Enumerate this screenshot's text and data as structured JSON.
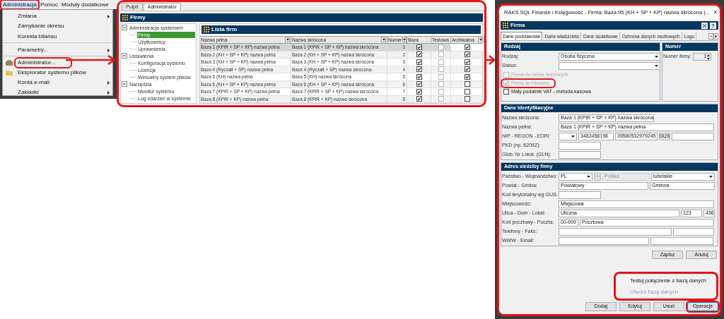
{
  "menu_bar": [
    {
      "label": "Administracja",
      "selected": true,
      "highlighted": true
    },
    {
      "label": "Pomoc",
      "selected": false,
      "highlighted": false
    },
    {
      "label": "Moduły dodatkowe",
      "selected": false,
      "highlighted": false
    }
  ],
  "menu": [
    {
      "label": "Zmiana",
      "kind": "plain",
      "submenu": true,
      "separator_after": false,
      "highlighted": false
    },
    {
      "label": "Zamykanie okresu",
      "kind": "plain",
      "submenu": false,
      "separator_after": false,
      "highlighted": false
    },
    {
      "label": "Korekta bilansu",
      "kind": "plain",
      "submenu": false,
      "separator_after": true,
      "highlighted": false
    },
    {
      "label": "Parametry...",
      "kind": "plain",
      "submenu": true,
      "separator_after": true,
      "highlighted": false
    },
    {
      "label": "Administrator...",
      "kind": "tool",
      "submenu": false,
      "separator_after": false,
      "highlighted": true
    },
    {
      "label": "Eksplorator systemu plików",
      "kind": "folder",
      "submenu": false,
      "separator_after": false,
      "highlighted": false
    },
    {
      "label": "Konta e-mail",
      "kind": "plain",
      "submenu": true,
      "separator_after": false,
      "highlighted": false
    },
    {
      "label": "Zakładki",
      "kind": "plain",
      "submenu": true,
      "separator_after": false,
      "highlighted": false
    }
  ],
  "admin_window": {
    "highlighted": true,
    "tabs": [
      {
        "label": "Pulpit",
        "selected": false
      },
      {
        "label": "Administrator",
        "selected": true
      }
    ],
    "title": "Firmy",
    "tree": [
      {
        "label": "Administracja systemem",
        "selected": false,
        "expanded": true,
        "children": [
          {
            "label": "Firmy",
            "selected": true
          },
          {
            "label": "Użytkownicy",
            "selected": false
          },
          {
            "label": "Uprawnienia",
            "selected": false
          }
        ]
      },
      {
        "label": "Ustawienia",
        "selected": false,
        "expanded": true,
        "children": [
          {
            "label": "Konfiguracja systemu",
            "selected": false
          },
          {
            "label": "Licencje",
            "selected": false
          },
          {
            "label": "Wirtualny system plików",
            "selected": false
          }
        ]
      },
      {
        "label": "Narzędzia",
        "selected": false,
        "expanded": true,
        "children": [
          {
            "label": "Monitor systemu",
            "selected": false
          },
          {
            "label": "Log zdarzeń w systemie",
            "selected": false
          }
        ]
      }
    ],
    "list": {
      "title": "Lista firm",
      "columns": [
        {
          "label": "Nazwa pełna",
          "filter": true
        },
        {
          "label": "Nazwa skrócona",
          "filter": true
        },
        {
          "label": "Numer",
          "filter": true
        },
        {
          "label": "Baza",
          "filter": false
        },
        {
          "label": "Testowa",
          "filter": false
        },
        {
          "label": "Archiwalna",
          "filter": true
        }
      ],
      "rows": [
        {
          "selected": true,
          "full": "Baza 1 (KPiR + SP + KP) nazwa pełna",
          "short": "Baza 1 (KPiR + SP + KP) nazwa skrócona",
          "number": "1",
          "baza": true,
          "testowa": false,
          "archiwalna": true
        },
        {
          "selected": false,
          "full": "Baza 2 (KH + SP + KP) nazwa pełna",
          "short": "Baza 2 (KH + SP + KP) nazwa skrócona",
          "number": "2",
          "baza": true,
          "testowa": false,
          "archiwalna": true
        },
        {
          "selected": false,
          "full": "Baza 3 (KH + SP + KP) nazwa pełna",
          "short": "Baza 3 (KH + SP + KP) nazwa skrócona",
          "number": "3",
          "baza": true,
          "testowa": false,
          "archiwalna": true
        },
        {
          "selected": false,
          "full": "Baza 4 (Ryczałt + SP) nazwa pełna",
          "short": "Baza 4 (Ryczałt + SP) nazwa skrócona",
          "number": "4",
          "baza": true,
          "testowa": false,
          "archiwalna": true
        },
        {
          "selected": false,
          "full": "Baza 5 (KH) nazwa pełna",
          "short": "Baza 5 (KH) nazwa skrócona",
          "number": "5",
          "baza": true,
          "testowa": false,
          "archiwalna": true
        },
        {
          "selected": false,
          "full": "Baza 6 (KH + SP + KP) nazwa pełna",
          "short": "Baza 6 (KH + SP + KP) nazwa skrócona",
          "number": "6",
          "baza": true,
          "testowa": false,
          "archiwalna": false
        },
        {
          "selected": false,
          "full": "Baza 7 (KPiR + SP + KP) nazwa pełna",
          "short": "Baza 7 (KPiR + SP + KP) nazwa skrócona",
          "number": "7",
          "baza": true,
          "testowa": false,
          "archiwalna": false
        },
        {
          "selected": false,
          "full": "Baza 8 (KPiR + KP) nazwa pełna",
          "short": "Baza 8 (KPiR + KP) nazwa skrócona",
          "number": "8",
          "baza": true,
          "testowa": false,
          "archiwalna": false
        }
      ]
    }
  },
  "dialog": {
    "highlighted": true,
    "title": "RAKS SQL Finanse i Księgowość - Firma: Baza 95 (KH + SP + KP) nazwa skrócona (...",
    "close": "×",
    "panel_title": "Firma",
    "help": "?",
    "tabs": [
      {
        "label": "Dane podstawowe",
        "selected": true
      },
      {
        "label": "Dane właściciela",
        "selected": false
      },
      {
        "label": "Dane dodatkowe",
        "selected": false
      },
      {
        "label": "Ochrona danych osobowych",
        "selected": false
      },
      {
        "label": "Logo",
        "selected": false
      }
    ],
    "rodzaj": {
      "title": "Rodzaj",
      "rows": [
        {
          "label": "Rodzaj:",
          "fields": [
            {
              "kind": "dropdown",
              "value": "Osoba fizyczna"
            }
          ]
        },
        {
          "label": "Status:",
          "fields": [
            {
              "kind": "dropdown"
            }
          ]
        }
      ],
      "checkboxes": [
        {
          "label": "Firma do celów testowych",
          "checked": false,
          "disabled": true,
          "highlighted": false
        },
        {
          "label": "Firma archiwalna",
          "checked": true,
          "disabled": true,
          "highlighted": true
        },
        {
          "label": "Mały podatnik VAT - metoda kasowa",
          "checked": false,
          "disabled": false,
          "highlighted": false
        }
      ]
    },
    "numer": {
      "title": "Numer",
      "label": "Numer firmy:",
      "value": "1"
    },
    "sections": [
      {
        "title": "Dane identyfikacyjne",
        "rows": [
          {
            "label": "Nazwa skrócona:",
            "fields": [
              {
                "kind": "text",
                "value": "Baza 1 (KPiR + SP + KP) nazwa skrócona"
              }
            ]
          },
          {
            "label": "Nazwa pełna:",
            "fields": [
              {
                "kind": "text",
                "value": "Baza 1 (KPiR + SP + KP) nazwa pełna"
              }
            ]
          },
          {
            "label": "NIP - REGON - EORI:",
            "fields": [
              {
                "kind": "dropdown"
              },
              {
                "kind": "text",
                "value": "3482458198"
              },
              {
                "kind": "text",
                "value": "39580532979245"
              },
              {
                "kind": "button",
                "value": "GUS"
              },
              {
                "kind": "text"
              }
            ]
          },
          {
            "label": "PKD (np. 6209Z):",
            "fields": [
              {
                "kind": "text"
              }
            ]
          },
          {
            "label": "Glob. Nr Lokal. (GLN):",
            "fields": [
              {
                "kind": "text"
              }
            ]
          }
        ]
      },
      {
        "title": "Adres siedziby firmy",
        "rows": [
          {
            "label": "Państwo - Województwo:",
            "fields": [
              {
                "kind": "dropdown",
                "value": "PL"
              },
              {
                "kind": "ellipsis",
                "value": "···"
              },
              {
                "kind": "disabled",
                "value": "Polska"
              },
              {
                "kind": "dropdown",
                "value": "lubelskie"
              }
            ]
          },
          {
            "label": "Powiat - Gmina:",
            "fields": [
              {
                "kind": "text",
                "value": "Powiatowy"
              },
              {
                "kind": "text",
                "value": "Gminna"
              }
            ]
          },
          {
            "label": "Kod terytorialny wg GUS:",
            "fields": [
              {
                "kind": "text"
              }
            ]
          },
          {
            "label": "Miejscowość:",
            "fields": [
              {
                "kind": "text",
                "value": "Miejscowa"
              }
            ]
          },
          {
            "label": "Ulica - Dom - Lokal:",
            "fields": [
              {
                "kind": "text",
                "value": "Uliczna"
              },
              {
                "kind": "text",
                "value": "123"
              },
              {
                "kind": "text",
                "value": "456"
              }
            ]
          },
          {
            "label": "Kod pocztowy - Poczta:",
            "fields": [
              {
                "kind": "text",
                "value": "00-999"
              },
              {
                "kind": "text",
                "value": "Pocztowa"
              }
            ]
          },
          {
            "label": "Telefony - Faks:",
            "fields": [
              {
                "kind": "text"
              },
              {
                "kind": "text"
              }
            ]
          },
          {
            "label": "WWW - Email:",
            "fields": [
              {
                "kind": "text"
              },
              {
                "kind": "text"
              }
            ]
          }
        ]
      }
    ],
    "form_buttons": [
      "Zapisz",
      "Anuluj"
    ],
    "popup": {
      "highlighted": true,
      "items": [
        {
          "label": "Testuj połączenie z bazą danych",
          "disabled": false
        },
        {
          "label": "Utwórz bazę danych",
          "disabled": true
        }
      ]
    },
    "bottom_buttons": [
      {
        "label": "Dodaj",
        "highlighted": false
      },
      {
        "label": "Edytuj",
        "highlighted": false
      },
      {
        "label": "Usuń",
        "highlighted": false
      },
      {
        "label": "Operacje",
        "highlighted": true
      }
    ]
  }
}
